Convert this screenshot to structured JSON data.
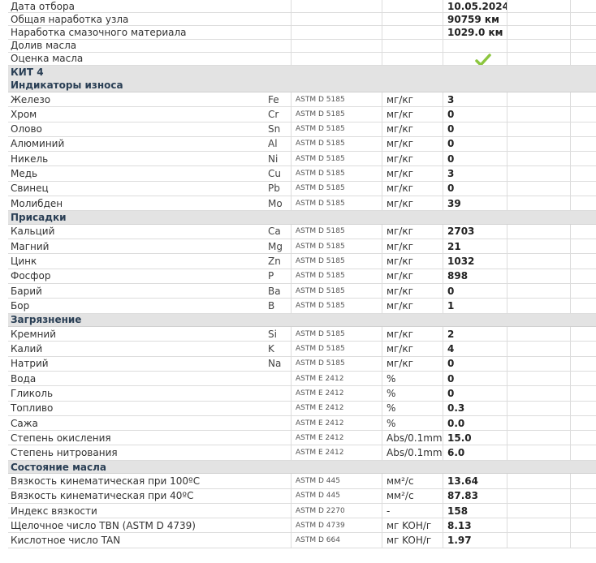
{
  "header_rows": [
    {
      "label": "Дата отбора",
      "value": "10.05.2024"
    },
    {
      "label": "Общая наработка узла",
      "value": "90759 км"
    },
    {
      "label": "Наработка смазочного материала",
      "value": "1029.0 км"
    },
    {
      "label": "Долив масла",
      "value": ""
    },
    {
      "label": "Оценка масла",
      "value": "",
      "status_icon": "green-check-icon",
      "status_color": "#8cc63f"
    }
  ],
  "kit_label": "КИТ 4",
  "sections": [
    {
      "title": "Индикаторы износа",
      "rows": [
        {
          "name": "Железо",
          "symbol": "Fe",
          "method": "ASTM D 5185",
          "unit": "мг/кг",
          "value": "3"
        },
        {
          "name": "Хром",
          "symbol": "Cr",
          "method": "ASTM D 5185",
          "unit": "мг/кг",
          "value": "0"
        },
        {
          "name": "Олово",
          "symbol": "Sn",
          "method": "ASTM D 5185",
          "unit": "мг/кг",
          "value": "0"
        },
        {
          "name": "Алюминий",
          "symbol": "Al",
          "method": "ASTM D 5185",
          "unit": "мг/кг",
          "value": "0"
        },
        {
          "name": "Никель",
          "symbol": "Ni",
          "method": "ASTM D 5185",
          "unit": "мг/кг",
          "value": "0"
        },
        {
          "name": "Медь",
          "symbol": "Cu",
          "method": "ASTM D 5185",
          "unit": "мг/кг",
          "value": "3"
        },
        {
          "name": "Свинец",
          "symbol": "Pb",
          "method": "ASTM D 5185",
          "unit": "мг/кг",
          "value": "0"
        },
        {
          "name": "Молибден",
          "symbol": "Mo",
          "method": "ASTM D 5185",
          "unit": "мг/кг",
          "value": "39"
        }
      ]
    },
    {
      "title": "Присадки",
      "rows": [
        {
          "name": "Кальций",
          "symbol": "Ca",
          "method": "ASTM D 5185",
          "unit": "мг/кг",
          "value": "2703"
        },
        {
          "name": "Магний",
          "symbol": "Mg",
          "method": "ASTM D 5185",
          "unit": "мг/кг",
          "value": "21"
        },
        {
          "name": "Цинк",
          "symbol": "Zn",
          "method": "ASTM D 5185",
          "unit": "мг/кг",
          "value": "1032"
        },
        {
          "name": "Фосфор",
          "symbol": "P",
          "method": "ASTM D 5185",
          "unit": "мг/кг",
          "value": "898"
        },
        {
          "name": "Барий",
          "symbol": "Ba",
          "method": "ASTM D 5185",
          "unit": "мг/кг",
          "value": "0"
        },
        {
          "name": "Бор",
          "symbol": "B",
          "method": "ASTM D 5185",
          "unit": "мг/кг",
          "value": "1"
        }
      ]
    },
    {
      "title": "Загрязнение",
      "rows": [
        {
          "name": "Кремний",
          "symbol": "Si",
          "method": "ASTM D 5185",
          "unit": "мг/кг",
          "value": "2"
        },
        {
          "name": "Калий",
          "symbol": "K",
          "method": "ASTM D 5185",
          "unit": "мг/кг",
          "value": "4"
        },
        {
          "name": "Натрий",
          "symbol": "Na",
          "method": "ASTM D 5185",
          "unit": "мг/кг",
          "value": "0"
        },
        {
          "name": "Вода",
          "symbol": "",
          "method": "ASTM E 2412",
          "unit": "%",
          "value": "0"
        },
        {
          "name": "Гликоль",
          "symbol": "",
          "method": "ASTM E 2412",
          "unit": "%",
          "value": "0"
        },
        {
          "name": "Топливо",
          "symbol": "",
          "method": "ASTM E 2412",
          "unit": "%",
          "value": "0.3"
        },
        {
          "name": "Сажа",
          "symbol": "",
          "method": "ASTM E 2412",
          "unit": "%",
          "value": "0.0"
        },
        {
          "name": "Степень окисления",
          "symbol": "",
          "method": "ASTM E 2412",
          "unit": "Abs/0.1mm",
          "value": "15.0"
        },
        {
          "name": "Степень нитрования",
          "symbol": "",
          "method": "ASTM E 2412",
          "unit": "Abs/0.1mm",
          "value": "6.0"
        }
      ]
    },
    {
      "title": "Состояние масла",
      "rows": [
        {
          "name": "Вязкость кинематическая при 100ºС",
          "symbol": "",
          "method": "ASTM D 445",
          "unit": "мм²/с",
          "value": "13.64"
        },
        {
          "name": "Вязкость кинематическая при 40ºС",
          "symbol": "",
          "method": "ASTM D 445",
          "unit": "мм²/с",
          "value": "87.83"
        },
        {
          "name": "Индекс вязкости",
          "symbol": "",
          "method": "ASTM D 2270",
          "unit": "-",
          "value": "158"
        },
        {
          "name": "Щелочное число TBN (ASTM D 4739)",
          "symbol": "",
          "method": "ASTM D 4739",
          "unit": "мг KOH/г",
          "value": "8.13"
        },
        {
          "name": "Кислотное число TAN",
          "symbol": "",
          "method": "ASTM D 664",
          "unit": "мг KOH/г",
          "value": "1.97"
        }
      ]
    }
  ]
}
